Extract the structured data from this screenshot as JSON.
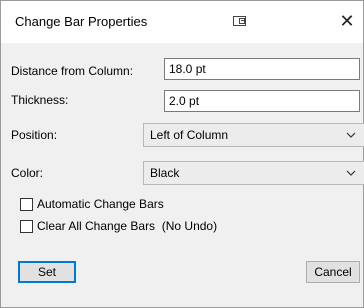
{
  "window": {
    "title": "Change Bar Properties",
    "close_label": "✕"
  },
  "fields": {
    "distance_label": "Distance from Column:",
    "distance_value": "18.0 pt",
    "thickness_label": "Thickness:",
    "thickness_value": "2.0 pt",
    "position_label": "Position:",
    "position_value": "Left of Column",
    "color_label": "Color:",
    "color_value": "Black"
  },
  "options": {
    "automatic_label": "Automatic Change Bars",
    "automatic_checked": false,
    "clear_label": "Clear All Change Bars  (No Undo)",
    "clear_checked": false
  },
  "buttons": {
    "set_label": "Set",
    "cancel_label": "Cancel"
  },
  "colors": {
    "accent": "#0078d7"
  }
}
